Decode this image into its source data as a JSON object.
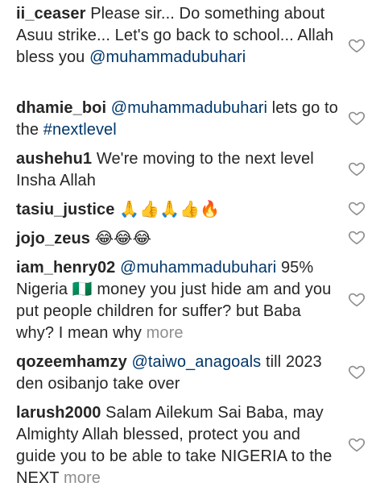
{
  "comments": [
    {
      "username": "ii_ceaser",
      "text": " Please sir... Do something about Asuu strike... Let's go back to school... Allah bless you ",
      "mention": "@muhammadubuhari"
    },
    {
      "username": "dhamie_boi",
      "mention": " @muhammadubuhari",
      "text": " lets go to the ",
      "hashtag": "#nextlevel"
    },
    {
      "username": "aushehu1",
      "text": " We're moving to the next level Insha Allah"
    },
    {
      "username": "tasiu_justice",
      "emojis": " 🙏👍🙏👍🔥"
    },
    {
      "username": "jojo_zeus",
      "emojis": " 😂😂😂"
    },
    {
      "username": "iam_henry02",
      "mention": " @muhammadubuhari",
      "text_a": " 95% Nigeria ",
      "flag": "🇳🇬",
      "text_b": " money you just hide am and you put people children for suffer? but Baba why? I mean why ",
      "more": "more"
    },
    {
      "username": "qozeemhamzy",
      "mention": " @taiwo_anagoals",
      "text": " till 2023 den osibanjo take over"
    },
    {
      "username": "larush2000",
      "text": " Salam Ailekum Sai Baba, may Almighty Allah blessed, protect you and guide you to be able to take NIGERIA to the NEXT ",
      "more": "more"
    }
  ],
  "icons": {
    "like": "heart-outline-icon"
  },
  "colors": {
    "text": "#262626",
    "link": "#00376b",
    "muted": "#8e8e8e",
    "icon": "#8e8e8e"
  }
}
